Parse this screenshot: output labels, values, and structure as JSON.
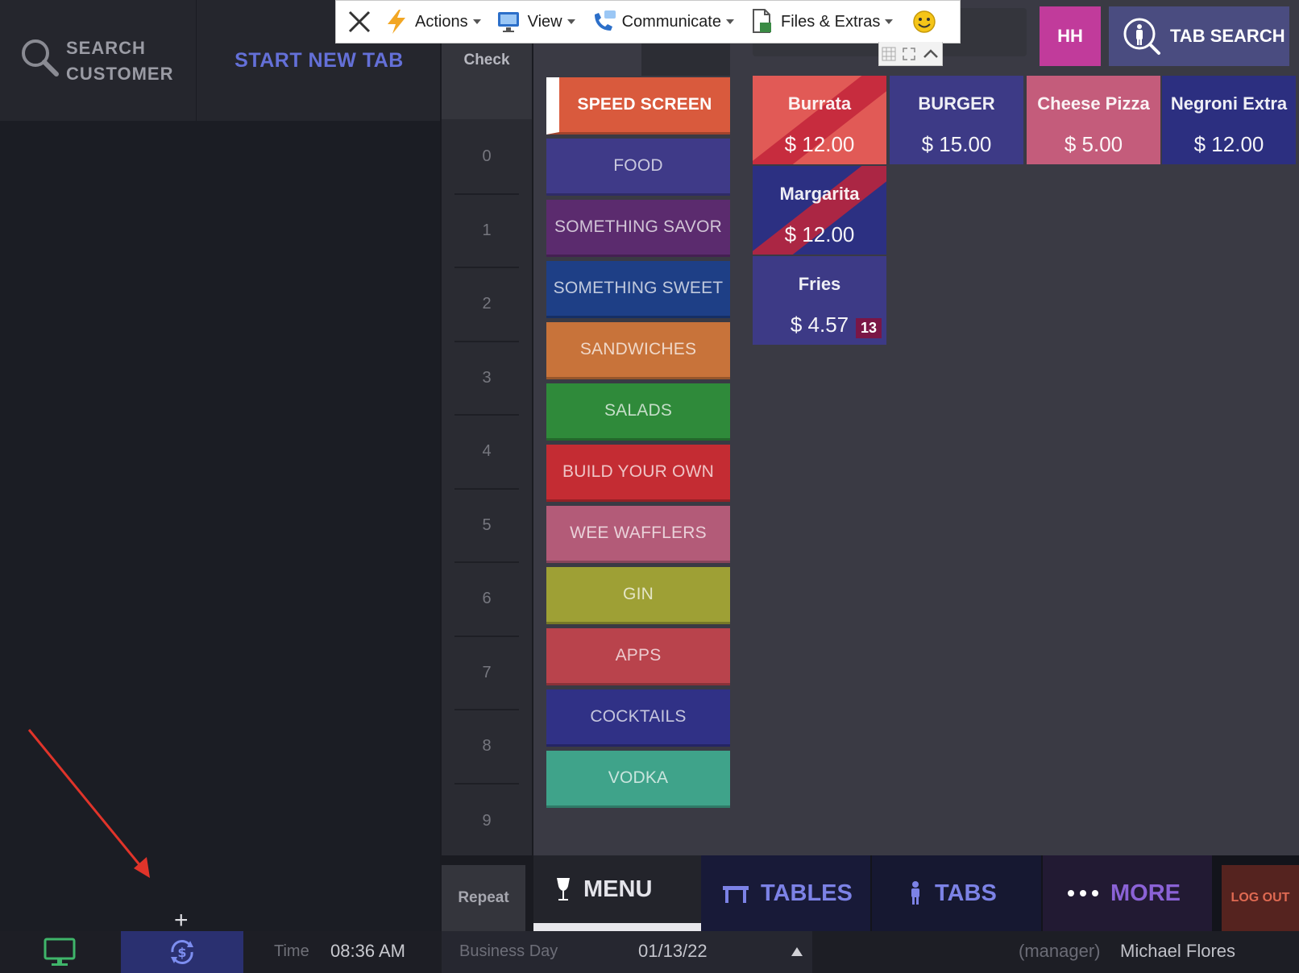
{
  "toolbar": {
    "actions_label": "Actions",
    "view_label": "View",
    "communicate_label": "Communicate",
    "files_label": "Files & Extras"
  },
  "header": {
    "search_customer_label": "SEARCH CUSTOMER",
    "start_new_tab_label": "START NEW TAB",
    "hh_label": "HH",
    "tab_search_label": "TAB SEARCH"
  },
  "check_column": {
    "heading": "Check",
    "numbers": [
      "0",
      "1",
      "2",
      "3",
      "4",
      "5",
      "6",
      "7",
      "8",
      "9"
    ],
    "repeat_label": "Repeat"
  },
  "categories": [
    {
      "label": "SPEED SCREEN",
      "color": "#d95a3d",
      "active": true
    },
    {
      "label": "FOOD",
      "color": "#3f3a88"
    },
    {
      "label": "SOMETHING SAVOR",
      "color": "#5b2b6e"
    },
    {
      "label": "SOMETHING SWEET",
      "color": "#1e3f86"
    },
    {
      "label": "SANDWICHES",
      "color": "#c8733a"
    },
    {
      "label": "SALADS",
      "color": "#2f8a3a"
    },
    {
      "label": "BUILD YOUR OWN",
      "color": "#c42c33"
    },
    {
      "label": "WEE WAFFLERS",
      "color": "#b35b78"
    },
    {
      "label": "GIN",
      "color": "#9ea035"
    },
    {
      "label": "APPS",
      "color": "#b9434c"
    },
    {
      "label": "COCKTAILS",
      "color": "#303186"
    },
    {
      "label": "VODKA",
      "color": "#3fa38a"
    }
  ],
  "items": [
    {
      "name": "Burrata",
      "price": "$ 12.00",
      "color": "#e15a56",
      "col": 0,
      "row": 0,
      "striped": true
    },
    {
      "name": "BURGER",
      "price": "$ 15.00",
      "color": "#3d3a86",
      "col": 1,
      "row": 0
    },
    {
      "name": "Cheese Pizza",
      "price": "$ 5.00",
      "color": "#c45c7b",
      "col": 2,
      "row": 0
    },
    {
      "name": "Negroni Extra",
      "price": "$ 12.00",
      "color": "#2c2f80",
      "col": 3,
      "row": 0
    },
    {
      "name": "Margarita",
      "price": "$ 12.00",
      "color": "#2c3082",
      "col": 0,
      "row": 1,
      "striped": true
    },
    {
      "name": "Fries",
      "price": "$ 4.57",
      "color": "#3d3a86",
      "col": 0,
      "row": 2,
      "badge": "13"
    }
  ],
  "bottom_nav": {
    "menu_label": "MENU",
    "tables_label": "TABLES",
    "tabs_label": "TABS",
    "more_label": "MORE",
    "logout_label": "LOG OUT"
  },
  "status_bar": {
    "time_label": "Time",
    "time_value": "08:36 AM",
    "business_day_label": "Business Day",
    "business_day_value": "01/13/22",
    "role": "(manager)",
    "user_name": "Michael Flores"
  }
}
